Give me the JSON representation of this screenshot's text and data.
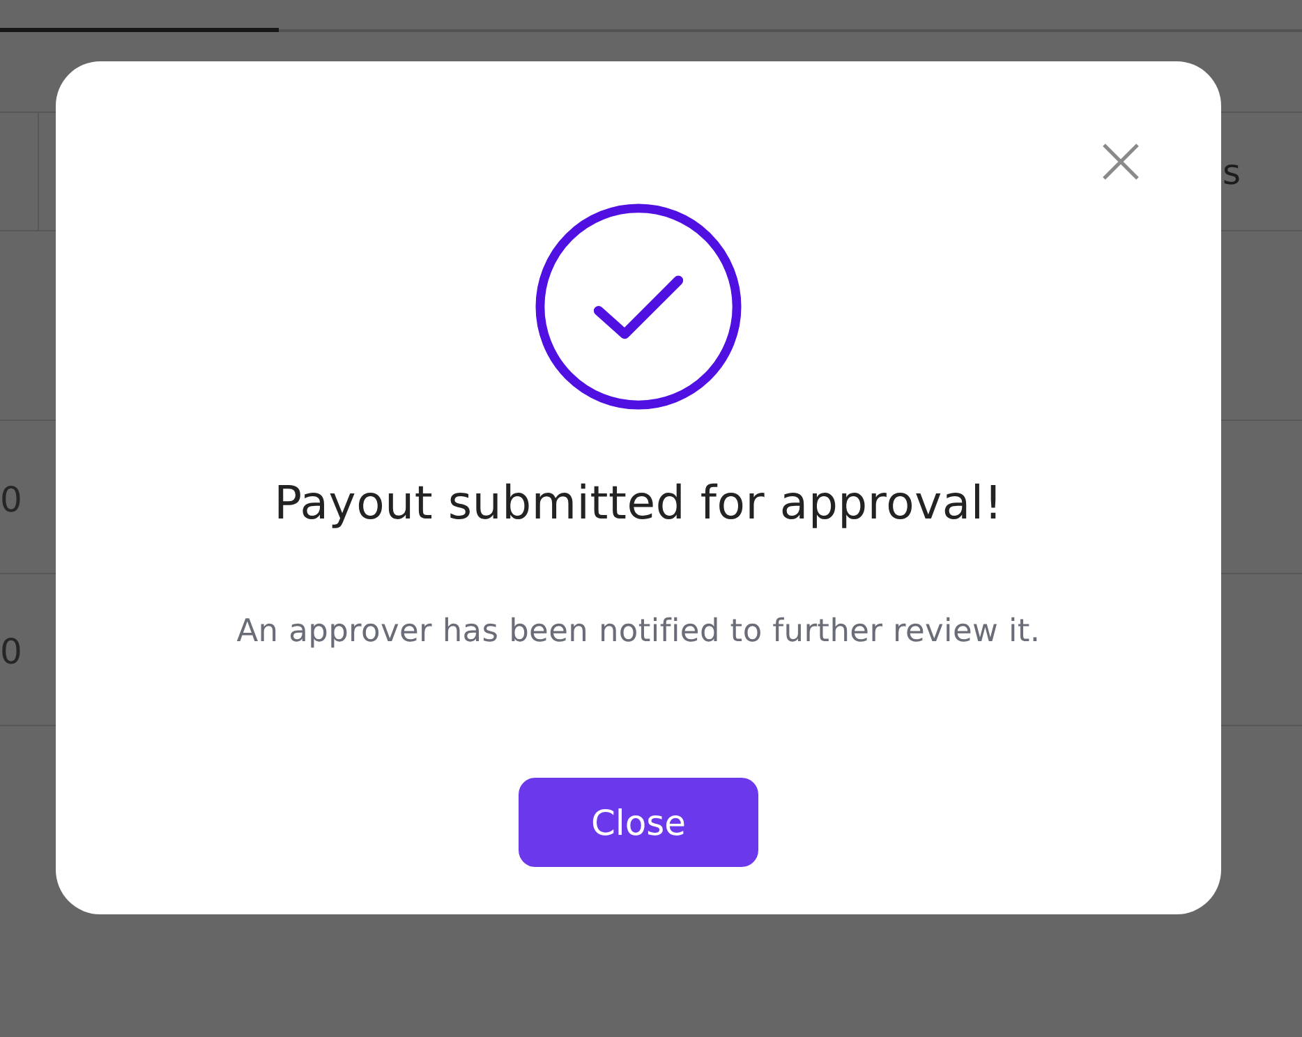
{
  "page": {
    "tabs": [
      {
        "selected": true
      }
    ],
    "table": {
      "header": {
        "column_cut": "s"
      },
      "rows": [
        {
          "cell": "0"
        },
        {
          "cell": "0"
        }
      ]
    }
  },
  "dialog": {
    "title": "Payout submitted for approval!",
    "message": "An approver has been notified to further review it.",
    "button": "Close"
  }
}
